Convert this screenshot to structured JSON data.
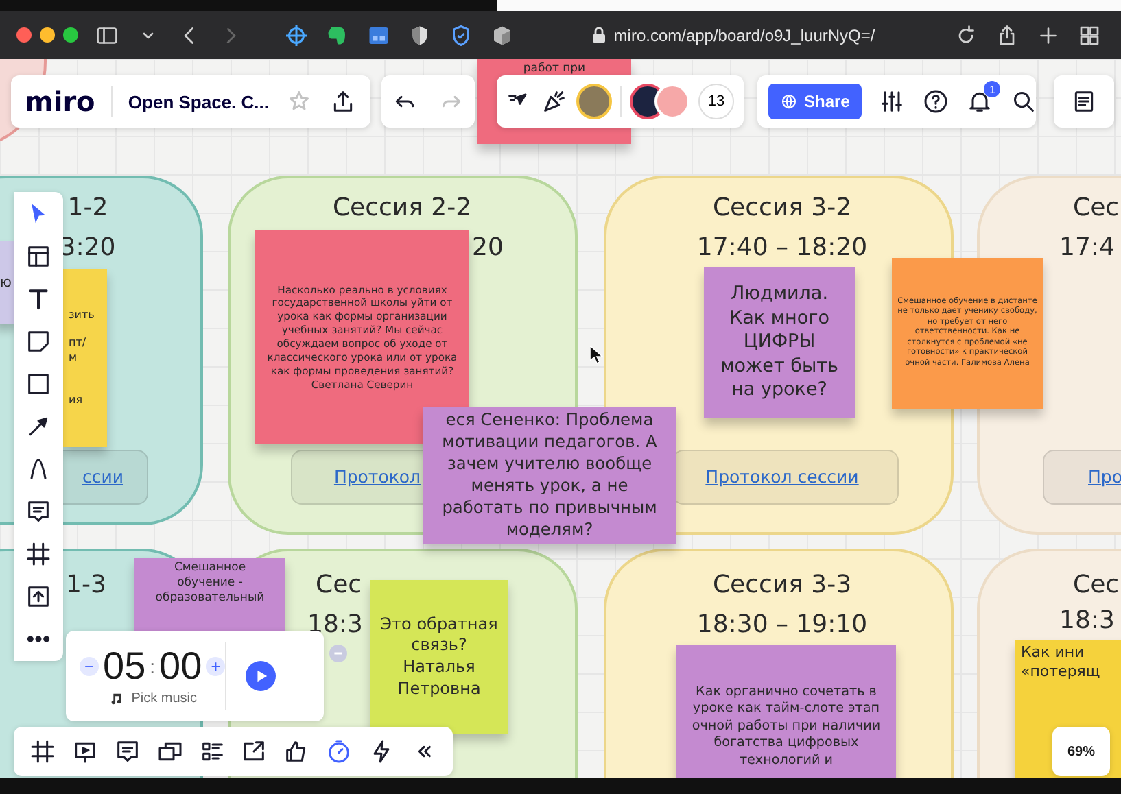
{
  "browser": {
    "url": "miro.com/app/board/o9J_luurNyQ=/"
  },
  "board_bar": {
    "logo": "miro",
    "board_name": "Open Space. C...",
    "collaborator_count": "13",
    "share_button": "Share",
    "notification_count": "1"
  },
  "sessions": [
    {
      "title": "1-2",
      "time": "3:20",
      "link": "ссии",
      "color": "#c2e5df"
    },
    {
      "title": "Сессия 2-2",
      "time": "20",
      "link": "Протокол",
      "color": "#e4f1d2"
    },
    {
      "title": "Сессия 3-2",
      "time": "17:40 – 18:20",
      "link": "Протокол сессии",
      "color": "#fbf0c8"
    },
    {
      "title": "Сес",
      "time": "17:4",
      "link": "Про",
      "color": "#f7eee2"
    },
    {
      "title": "1-3",
      "color": "#c2e5df"
    },
    {
      "title": "Сес",
      "time": "18:3",
      "color": "#e4f1d2"
    },
    {
      "title": "Сессия 3-3",
      "time": "18:30 – 19:10",
      "color": "#fbf0c8"
    },
    {
      "title": "Сес",
      "time": "18:3",
      "color": "#f7eee2"
    }
  ],
  "stickies": [
    {
      "text": "ю",
      "color": "#cdc8e8"
    },
    {
      "text": "зить\n\nпт/\nм\n\n\nия",
      "color": "#f6d54a"
    },
    {
      "text": "Насколько реально в условиях государственной школы уйти от урока как формы организации учебных занятий? Мы сейчас обсуждаем вопрос об уходе от классического урока или от урока как формы проведения занятий?\nСветлана Северин",
      "color": "#ef6b7e"
    },
    {
      "text": "еся Сененко: Проблема мотивации педагогов. А зачем учителю вообще менять урок, а не работать по привычным моделям?",
      "color": "#c48ad0"
    },
    {
      "text": "Людмила.\nКак много\nЦИФРЫ\nможет быть\nна уроке?",
      "color": "#c48ad0"
    },
    {
      "text": "Смешанное обучение в дистанте не только дает ученику свободу, но требует от него ответственности. Как не столкнутся с проблемой «не готовности» к практической очной части. Галимова Алена",
      "color": "#fb9a4a"
    },
    {
      "text": "Смешанное\nобучение -\nобразовательный",
      "color": "#c48ad0"
    },
    {
      "text": "Это обратная\nсвязь?\nНаталья\nПетровна",
      "color": "#d5e657"
    },
    {
      "text": "Как органично сочетать в уроке как тайм-слоте этап очной работы при наличии богатства цифровых технологий и",
      "color": "#c48ad0"
    },
    {
      "text": "Как ини\n«потерящ",
      "color": "#f5d23c"
    },
    {
      "text": "работ при",
      "color": "#ef6b7e"
    }
  ],
  "left_tools": [
    {
      "kind": "select",
      "selected": true
    },
    {
      "kind": "template",
      "selected": false
    },
    {
      "kind": "text",
      "selected": false
    },
    {
      "kind": "sticky",
      "selected": false
    },
    {
      "kind": "shape",
      "selected": false
    },
    {
      "kind": "line",
      "selected": false
    },
    {
      "kind": "pen",
      "selected": false
    },
    {
      "kind": "comment",
      "selected": false
    },
    {
      "kind": "frame",
      "selected": false
    },
    {
      "kind": "upload",
      "selected": false
    },
    {
      "kind": "more",
      "selected": false
    }
  ],
  "bottom_tools": [
    {
      "kind": "frame",
      "selected": false
    },
    {
      "kind": "presentation",
      "selected": false
    },
    {
      "kind": "comment",
      "selected": false
    },
    {
      "kind": "cards",
      "selected": false
    },
    {
      "kind": "list",
      "selected": false
    },
    {
      "kind": "screenshare",
      "selected": false
    },
    {
      "kind": "vote",
      "selected": false
    },
    {
      "kind": "timer",
      "selected": true
    },
    {
      "kind": "lightning",
      "selected": false
    },
    {
      "kind": "collapse",
      "selected": false
    }
  ],
  "timer": {
    "decrement": "−",
    "minutes": "05",
    "separator": ":",
    "seconds": "00",
    "increment": "+",
    "music_label": "Pick music"
  },
  "zoom": "69%"
}
